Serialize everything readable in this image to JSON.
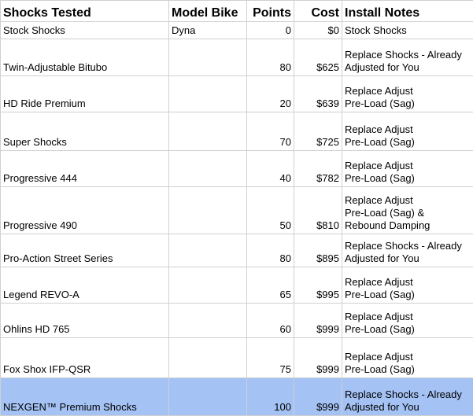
{
  "table": {
    "headers": [
      "Shocks Tested",
      "Model Bike",
      "Points",
      "Cost",
      "Install Notes"
    ],
    "rows": [
      {
        "shock": "Stock Shocks",
        "bike": "Dyna",
        "points": "0",
        "cost": "$0",
        "notes": "Stock Shocks"
      },
      {
        "shock": "Twin-Adjustable Bitubo",
        "bike": "",
        "points": "80",
        "cost": "$625",
        "notes": "Replace Shocks - Already\nAdjusted for You"
      },
      {
        "shock": "HD Ride Premium",
        "bike": "",
        "points": "20",
        "cost": "$639",
        "notes": "Replace  Adjust\nPre-Load (Sag)"
      },
      {
        "shock": "Super Shocks",
        "bike": "",
        "points": "70",
        "cost": "$725",
        "notes": "Replace Adjust\nPre-Load (Sag)"
      },
      {
        "shock": "Progressive 444",
        "bike": "",
        "points": "40",
        "cost": "$782",
        "notes": "Replace  Adjust\nPre-Load (Sag)"
      },
      {
        "shock": "Progressive 490",
        "bike": "",
        "points": "50",
        "cost": "$810",
        "notes": "Replace  Adjust\nPre-Load (Sag) &\nRebound Damping"
      },
      {
        "shock": "Pro-Action Street Series",
        "bike": "",
        "points": "80",
        "cost": "$895",
        "notes": "Replace Shocks - Already\nAdjusted for You"
      },
      {
        "shock": "Legend REVO-A",
        "bike": "",
        "points": "65",
        "cost": "$995",
        "notes": "Replace  Adjust\nPre-Load (Sag)"
      },
      {
        "shock": "Ohlins HD 765",
        "bike": "",
        "points": "60",
        "cost": "$999",
        "notes": "Replace  Adjust\nPre-Load (Sag)"
      },
      {
        "shock": "Fox Shox IFP-QSR",
        "bike": "",
        "points": "75",
        "cost": "$999",
        "notes": "Replace Adjust\nPre-Load (Sag)"
      },
      {
        "shock": "NEXGEN™ Premium Shocks",
        "bike": "",
        "points": "100",
        "cost": "$999",
        "notes": "Replace Shocks - Already\nAdjusted for You"
      }
    ]
  },
  "colors": {
    "highlight_row": "#a4c2f4",
    "gridline": "#d0d0d0"
  }
}
